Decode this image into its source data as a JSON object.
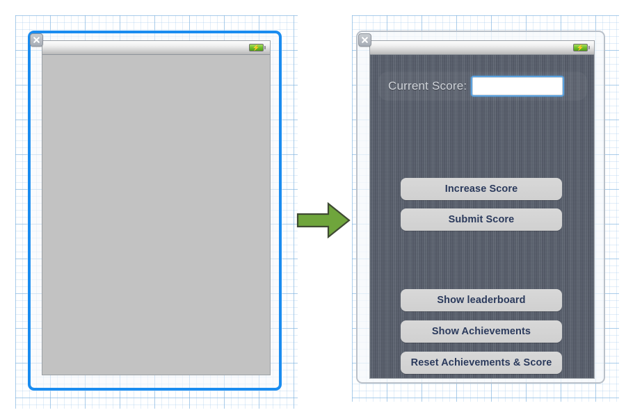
{
  "canvas": {
    "background_color": "#ffffff",
    "grid_minor_color": "#a0c8eb",
    "grid_major_color": "#7ab0de"
  },
  "arrow": {
    "name": "transition-arrow",
    "direction": "right",
    "fill_color": "#6fa53c",
    "stroke_color": "#3f4a33"
  },
  "left_device": {
    "name": "before-view-controller",
    "selected": true,
    "selection_color": "#1a8cf0",
    "close_badge": "close-icon",
    "statusbar": {
      "battery_icon": "battery-charging-icon",
      "battery_color": "#72c12e"
    },
    "screen": {
      "background_color": "#c2c2c2",
      "content": ""
    }
  },
  "right_device": {
    "name": "after-view-controller",
    "selected": false,
    "border_color": "#b9c0c9",
    "close_badge": "close-icon",
    "statusbar": {
      "battery_icon": "battery-charging-icon",
      "battery_color": "#72c12e"
    },
    "screen": {
      "background_color": "#585f6d",
      "texture": "linen"
    },
    "score": {
      "label": "Current Score:",
      "value": "",
      "placeholder": "",
      "field_focused": true,
      "focus_ring_color": "#5aa2e0"
    },
    "buttons": [
      {
        "id": "increase-score",
        "label": "Increase Score"
      },
      {
        "id": "submit-score",
        "label": "Submit Score"
      },
      {
        "id": "show-leaderboard",
        "label": "Show leaderboard"
      },
      {
        "id": "show-achievements",
        "label": "Show Achievements"
      },
      {
        "id": "reset-achievements-score",
        "label": "Reset Achievements & Score"
      }
    ],
    "button_text_color": "#2b3a5c",
    "button_face_color": "#d2d2d2"
  }
}
